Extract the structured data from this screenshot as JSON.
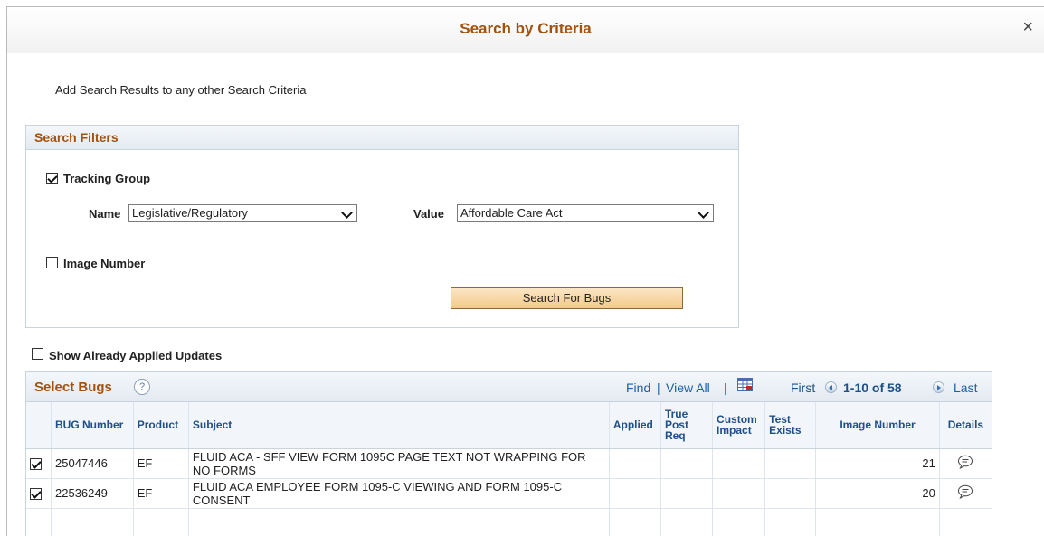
{
  "dialog": {
    "title": "Search by Criteria",
    "close_label": "×"
  },
  "intro_text": "Add Search Results to any other Search Criteria",
  "filters": {
    "header": "Search Filters",
    "tracking_group": {
      "label": "Tracking Group",
      "checked": true
    },
    "name": {
      "label": "Name",
      "value": "Legislative/Regulatory"
    },
    "value": {
      "label": "Value",
      "value": "Affordable Care Act"
    },
    "image_number": {
      "label": "Image Number",
      "checked": false
    },
    "search_button": "Search For Bugs"
  },
  "show_applied": {
    "label": "Show Already Applied Updates",
    "checked": false
  },
  "grid": {
    "title": "Select Bugs",
    "help_label": "?",
    "find": "Find",
    "sep": "|",
    "view_all": "View All",
    "first": "First",
    "range": "1-10 of 58",
    "last": "Last",
    "columns": {
      "bug_number": "BUG Number",
      "product": "Product",
      "subject": "Subject",
      "applied": "Applied",
      "true_post_req": "True Post Req",
      "custom_impact": "Custom Impact",
      "test_exists": "Test Exists",
      "image_number": "Image Number",
      "details": "Details"
    },
    "rows": [
      {
        "checked": true,
        "bug": "25047446",
        "product": "EF",
        "subject": "FLUID ACA - SFF VIEW FORM 1095C PAGE TEXT NOT WRAPPING FOR NO FORMS",
        "image": "21"
      },
      {
        "checked": true,
        "bug": "22536249",
        "product": "EF",
        "subject": "FLUID ACA EMPLOYEE FORM 1095-C VIEWING AND FORM 1095-C CONSENT",
        "image": "20"
      }
    ]
  },
  "colors": {
    "accent": "#a2510f",
    "link": "#1f5fa8",
    "button": "#f3c98a"
  }
}
